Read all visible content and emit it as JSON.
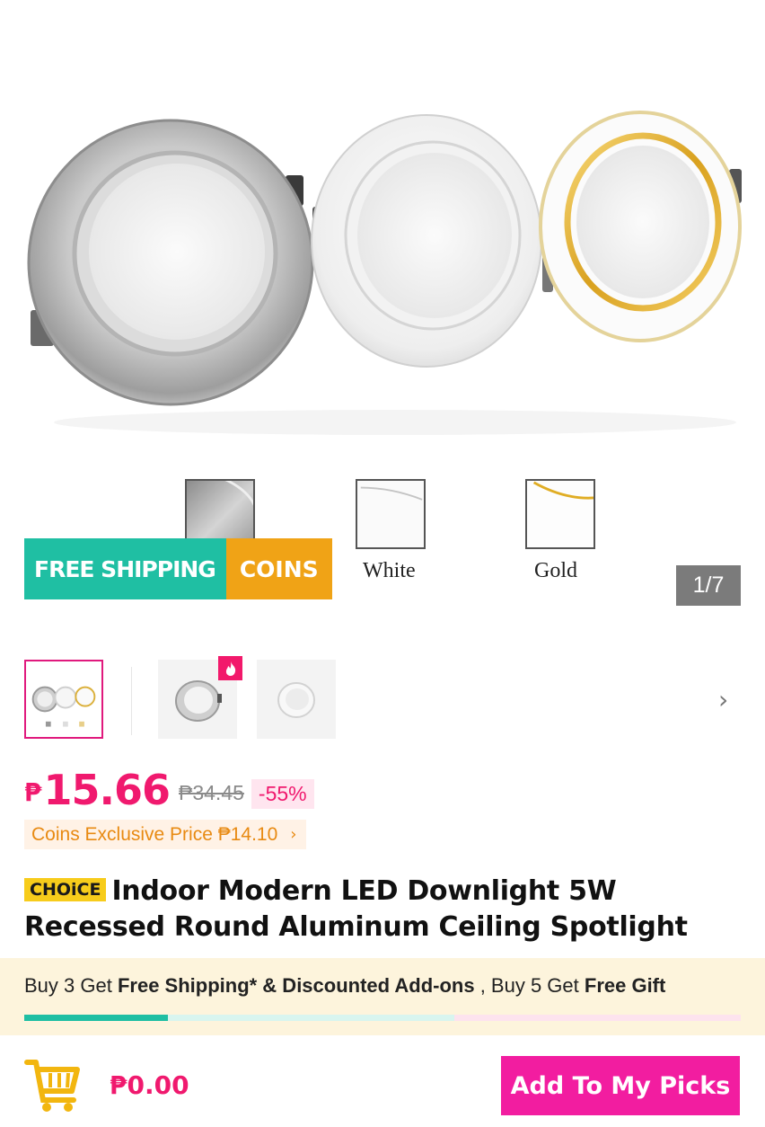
{
  "hero": {
    "swatch_labels": {
      "white": "White",
      "gold": "Gold"
    },
    "promo": {
      "free_shipping": "FREE SHIPPING",
      "coins": "COINS"
    },
    "image_counter": "1/7"
  },
  "thumbnails": {
    "badge_icon": "fire-icon",
    "next_icon": "chevron-right-icon"
  },
  "price": {
    "currency": "₱",
    "current": "15.66",
    "original": "₱34.45",
    "discount": "-55%",
    "coins_exclusive": "Coins Exclusive Price ₱14.10",
    "coins_chevron": "›"
  },
  "product": {
    "badge": "CHOiCE",
    "title": "Indoor Modern LED Downlight 5W Recessed Round Aluminum Ceiling Spotlight"
  },
  "bundle": {
    "part1": "Buy 3 Get ",
    "part1_bold": "Free Shipping* & Discounted Add-ons",
    "part2": " , Buy 5 Get ",
    "part2_bold": "Free Gift"
  },
  "bottom_bar": {
    "cart_icon": "shopping-cart-icon",
    "cart_total": "₱0.00",
    "add_button": "Add To My Picks"
  },
  "colors": {
    "accent_pink": "#f0196e",
    "button_magenta": "#f21da0",
    "teal": "#1fbfa3",
    "orange": "#f0a316",
    "choice_yellow": "#f7cc1b"
  }
}
